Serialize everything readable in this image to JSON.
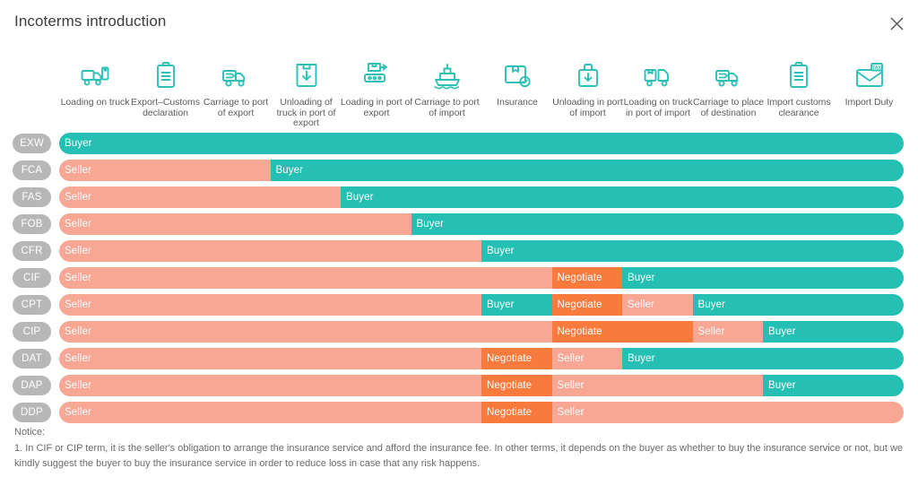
{
  "header": {
    "title": "Incoterms introduction",
    "close_icon": "close-icon"
  },
  "columns": [
    {
      "icon": "loading-on-truck-icon",
      "label": "Loading on truck"
    },
    {
      "icon": "export-customs-declaration-icon",
      "label": "Export–Customs declaration"
    },
    {
      "icon": "carriage-to-port-of-export-icon",
      "label": "Carriage to port of export"
    },
    {
      "icon": "unloading-of-truck-in-port-of-export-icon",
      "label": "Unloading of truck in port of export"
    },
    {
      "icon": "loading-in-port-of-export-icon",
      "label": "Loading in port of export"
    },
    {
      "icon": "carriage-to-port-of-import-icon",
      "label": "Carriage to port of import"
    },
    {
      "icon": "insurance-icon",
      "label": "Insurance"
    },
    {
      "icon": "unloading-in-port-of-import-icon",
      "label": "Unloading in port of import"
    },
    {
      "icon": "loading-on-truck-in-port-of-import-icon",
      "label": "Loading on truck in port of import"
    },
    {
      "icon": "carriage-to-place-of-destination-icon",
      "label": "Carriage to place of destination"
    },
    {
      "icon": "import-customs-clearance-icon",
      "label": "Import customs clearance"
    },
    {
      "icon": "import-duty-icon",
      "label": "Import Duty"
    }
  ],
  "legend_colors": {
    "seller": "#f9a795",
    "buyer": "#26bfb4",
    "negotiate": "#f97a3d",
    "term_pill": "#b7b7b7"
  },
  "chart_data": {
    "type": "bar",
    "title": "Incoterms introduction",
    "subtitle": "Responsibility split by Incoterm across the 12 shipping cost stages",
    "xlabel": "",
    "ylabel": "",
    "grid": false,
    "legend_position": "none",
    "categories": [
      "Loading on truck",
      "Export–Customs declaration",
      "Carriage to port of export",
      "Unloading of truck in port of export",
      "Loading in port of export",
      "Carriage to port of import",
      "Insurance",
      "Unloading in port of import",
      "Loading on truck in port of import",
      "Carriage to place of destination",
      "Import customs clearance",
      "Import Duty"
    ],
    "total_columns": 12,
    "series": [
      {
        "name": "EXW",
        "segments": [
          {
            "label": "Buyer",
            "role": "buyer",
            "start": 0,
            "span": 12
          }
        ]
      },
      {
        "name": "FCA",
        "segments": [
          {
            "label": "Seller",
            "role": "seller",
            "start": 0,
            "span": 3
          },
          {
            "label": "Buyer",
            "role": "buyer",
            "start": 3,
            "span": 9
          }
        ]
      },
      {
        "name": "FAS",
        "segments": [
          {
            "label": "Seller",
            "role": "seller",
            "start": 0,
            "span": 4
          },
          {
            "label": "Buyer",
            "role": "buyer",
            "start": 4,
            "span": 8
          }
        ]
      },
      {
        "name": "FOB",
        "segments": [
          {
            "label": "Seller",
            "role": "seller",
            "start": 0,
            "span": 5
          },
          {
            "label": "Buyer",
            "role": "buyer",
            "start": 5,
            "span": 7
          }
        ]
      },
      {
        "name": "CFR",
        "segments": [
          {
            "label": "Seller",
            "role": "seller",
            "start": 0,
            "span": 6
          },
          {
            "label": "Buyer",
            "role": "buyer",
            "start": 6,
            "span": 6
          }
        ]
      },
      {
        "name": "CIF",
        "segments": [
          {
            "label": "Seller",
            "role": "seller",
            "start": 0,
            "span": 7
          },
          {
            "label": "Negotiate",
            "role": "negotiate",
            "start": 7,
            "span": 1
          },
          {
            "label": "Buyer",
            "role": "buyer",
            "start": 8,
            "span": 4
          }
        ]
      },
      {
        "name": "CPT",
        "segments": [
          {
            "label": "Seller",
            "role": "seller",
            "start": 0,
            "span": 6
          },
          {
            "label": "Buyer",
            "role": "buyer",
            "start": 6,
            "span": 1
          },
          {
            "label": "Negotiate",
            "role": "negotiate",
            "start": 7,
            "span": 1
          },
          {
            "label": "Seller",
            "role": "seller",
            "start": 8,
            "span": 1
          },
          {
            "label": "Buyer",
            "role": "buyer",
            "start": 9,
            "span": 3
          }
        ]
      },
      {
        "name": "CIP",
        "segments": [
          {
            "label": "Seller",
            "role": "seller",
            "start": 0,
            "span": 7
          },
          {
            "label": "Negotiate",
            "role": "negotiate",
            "start": 7,
            "span": 2
          },
          {
            "label": "Seller",
            "role": "seller",
            "start": 9,
            "span": 1
          },
          {
            "label": "Buyer",
            "role": "buyer",
            "start": 10,
            "span": 2
          }
        ]
      },
      {
        "name": "DAT",
        "segments": [
          {
            "label": "Seller",
            "role": "seller",
            "start": 0,
            "span": 6
          },
          {
            "label": "Negotiate",
            "role": "negotiate",
            "start": 6,
            "span": 1
          },
          {
            "label": "Seller",
            "role": "seller",
            "start": 7,
            "span": 1
          },
          {
            "label": "Buyer",
            "role": "buyer",
            "start": 8,
            "span": 4
          }
        ]
      },
      {
        "name": "DAP",
        "segments": [
          {
            "label": "Seller",
            "role": "seller",
            "start": 0,
            "span": 6
          },
          {
            "label": "Negotiate",
            "role": "negotiate",
            "start": 6,
            "span": 1
          },
          {
            "label": "Seller",
            "role": "seller",
            "start": 7,
            "span": 3
          },
          {
            "label": "Buyer",
            "role": "buyer",
            "start": 10,
            "span": 2
          }
        ]
      },
      {
        "name": "DDP",
        "segments": [
          {
            "label": "Seller",
            "role": "seller",
            "start": 0,
            "span": 6
          },
          {
            "label": "Negotiate",
            "role": "negotiate",
            "start": 6,
            "span": 1
          },
          {
            "label": "Seller",
            "role": "seller",
            "start": 7,
            "span": 5
          }
        ]
      }
    ]
  },
  "notice": {
    "heading": "Notice:",
    "item1": "1. In CIF or CIP term, it is the seller's obligation to arrange the insurance service and afford the insurance fee. In other terms, it depends on the buyer as whether to buy the insurance service or not, but we kindly suggest the buyer to buy the insurance service in order to reduce loss in case that any risk happens."
  }
}
